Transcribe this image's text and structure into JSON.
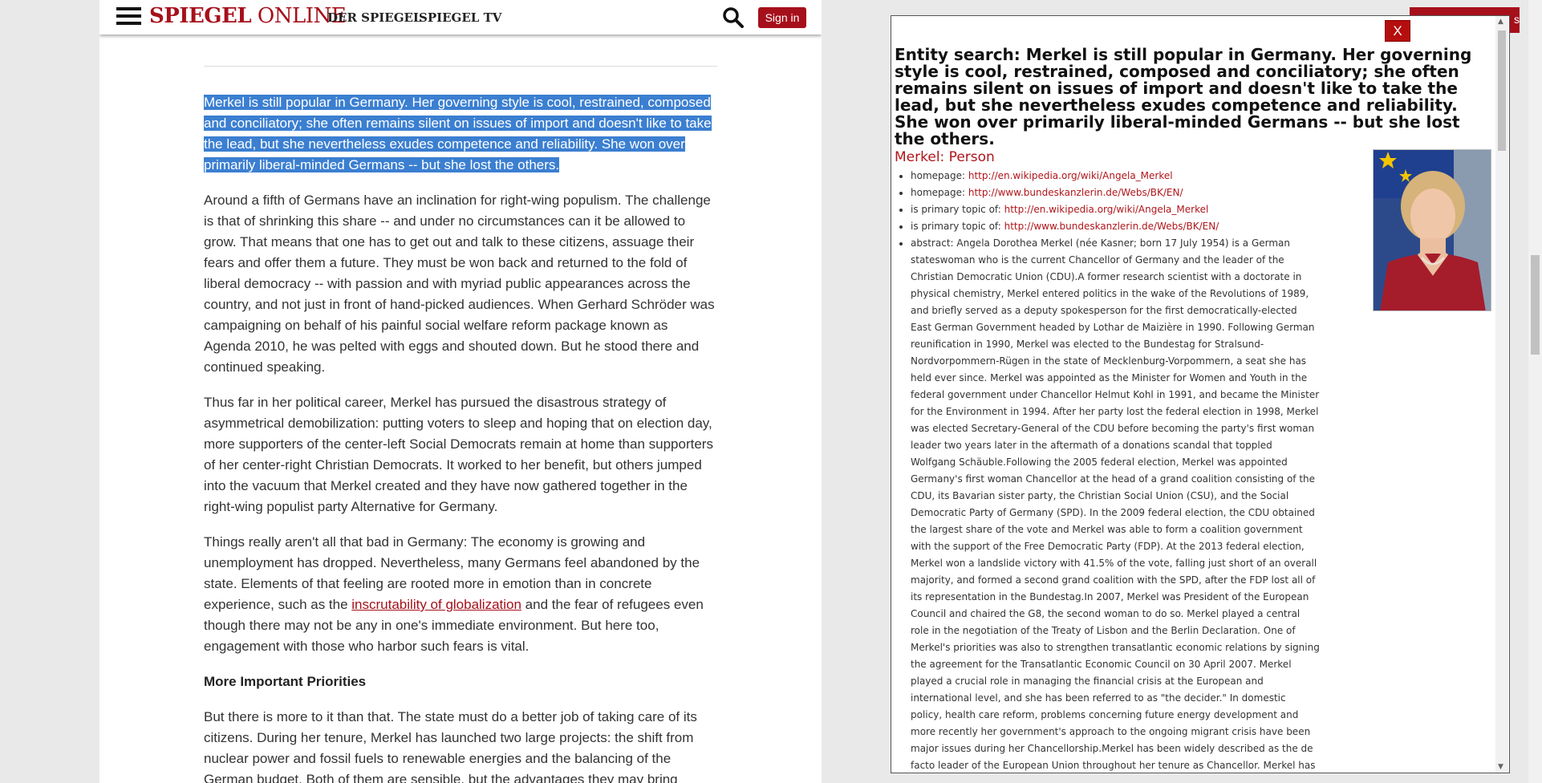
{
  "header": {
    "logo_bold": "SPIEGEL",
    "logo_rest": " ONLINE",
    "brand_derspiegel": "DER SPIEGEL",
    "brand_spiegeltv": "SPIEGEL TV",
    "signin_label": "Sign in"
  },
  "article": {
    "highlighted_paragraph": "Merkel is still popular in Germany. Her governing style is cool, restrained, composed and conciliatory; she often remains silent on issues of import and doesn't like to take the lead, but she nevertheless exudes competence and reliability. She won over primarily liberal-minded Germans -- but she lost the others.",
    "p2": "Around a fifth of Germans have an inclination for right-wing populism. The challenge is that of shrinking this share -- and under no circumstances can it be allowed to grow. That means that one has to get out and talk to these citizens, assuage their fears and offer them a future. They must be won back and returned to the fold of liberal democracy -- with passion and with myriad public appearances across the country, and not just in front of hand-picked audiences. When Gerhard Schröder was campaigning on behalf of his painful social welfare reform package known as Agenda 2010, he was pelted with eggs and shouted down. But he stood there and continued speaking.",
    "p3": "Thus far in her political career, Merkel has pursued the disastrous strategy of asymmetrical demobilization: putting voters to sleep and hoping that on election day, more supporters of the center-left Social Democrats remain at home than supporters of her center-right Christian Democrats. It worked to her benefit, but others jumped into the vacuum that Merkel created and they have now gathered together in the right-wing populist party Alternative for Germany.",
    "p4_before": "Things really aren't all that bad in Germany: The economy is growing and unemployment has dropped. Nevertheless, many Germans feel abandoned by the state. Elements of that feeling are rooted more in emotion than in concrete experience, such as the ",
    "p4_link": "inscrutability of globalization",
    "p4_after": " and the fear of refugees even though there may not be any in one's immediate environment. But here too, engagement with those who harbor such fears is vital.",
    "subhead": "More Important Priorities",
    "p5": "But there is more to it than that. The state must do a better job of taking care of its citizens. During her tenure, Merkel has launched two large projects: the shift from nuclear power and fossil fuels to renewable energies and the balancing of the German budget. Both of them are sensible, but the advantages they may bring"
  },
  "popup": {
    "close_label": "X",
    "title": "Entity search: Merkel is still popular in Germany. Her governing style is cool, restrained, composed and conciliatory; she often remains silent on issues of import and doesn't like to take the lead, but she nevertheless exudes competence and reliability. She won over primarily liberal-minded Germans -- but she lost the others.",
    "entity": "Merkel: Person",
    "properties": [
      {
        "label": "homepage: ",
        "value": "http://en.wikipedia.org/wiki/Angela_Merkel"
      },
      {
        "label": "homepage: ",
        "value": "http://www.bundeskanzlerin.de/Webs/BK/EN/"
      },
      {
        "label": "is primary topic of: ",
        "value": "http://en.wikipedia.org/wiki/Angela_Merkel"
      },
      {
        "label": "is primary topic of: ",
        "value": "http://www.bundeskanzlerin.de/Webs/BK/EN/"
      }
    ],
    "abstract": "abstract: Angela Dorothea Merkel (née Kasner; born 17 July 1954) is a German stateswoman who is the current Chancellor of Germany and the leader of the Christian Democratic Union (CDU).A former research scientist with a doctorate in physical chemistry, Merkel entered politics in the wake of the Revolutions of 1989, and briefly served as a deputy spokesperson for the first democratically-elected East German Government headed by Lothar de Maizière in 1990. Following German reunification in 1990, Merkel was elected to the Bundestag for Stralsund-Nordvorpommern-Rügen in the state of Mecklenburg-Vorpommern, a seat she has held ever since. Merkel was appointed as the Minister for Women and Youth in the federal government under Chancellor Helmut Kohl in 1991, and became the Minister for the Environment in 1994. After her party lost the federal election in 1998, Merkel was elected Secretary-General of the CDU before becoming the party's first woman leader two years later in the aftermath of a donations scandal that toppled Wolfgang Schäuble.Following the 2005 federal election, Merkel was appointed Germany's first woman Chancellor at the head of a grand coalition consisting of the CDU, its Bavarian sister party, the Christian Social Union (CSU), and the Social Democratic Party of Germany (SPD). In the 2009 federal election, the CDU obtained the largest share of the vote and Merkel was able to form a coalition government with the support of the Free Democratic Party (FDP). At the 2013 federal election, Merkel won a landslide victory with 41.5% of the vote, falling just short of an overall majority, and formed a second grand coalition with the SPD, after the FDP lost all of its representation in the Bundestag.In 2007, Merkel was President of the European Council and chaired the G8, the second woman to do so. Merkel played a central role in the negotiation of the Treaty of Lisbon and the Berlin Declaration. One of Merkel's priorities was also to strengthen transatlantic economic relations by signing the agreement for the Transatlantic Economic Council on 30 April 2007. Merkel played a crucial role in managing the financial crisis at the European and international level, and she has been referred to as \"the decider.\" In domestic policy, health care reform, problems concerning future energy development and more recently her government's approach to the ongoing migrant crisis have been major issues during her Chancellorship.Merkel has been widely described as the de facto leader of the European Union throughout her tenure as Chancellor. Merkel has twice been named the world's second most powerful person"
  },
  "background_button_fragment": "s",
  "colors": {
    "brand_red": "#a6101b",
    "selection": "#3b7fd1",
    "link_red": "#b0151a"
  }
}
